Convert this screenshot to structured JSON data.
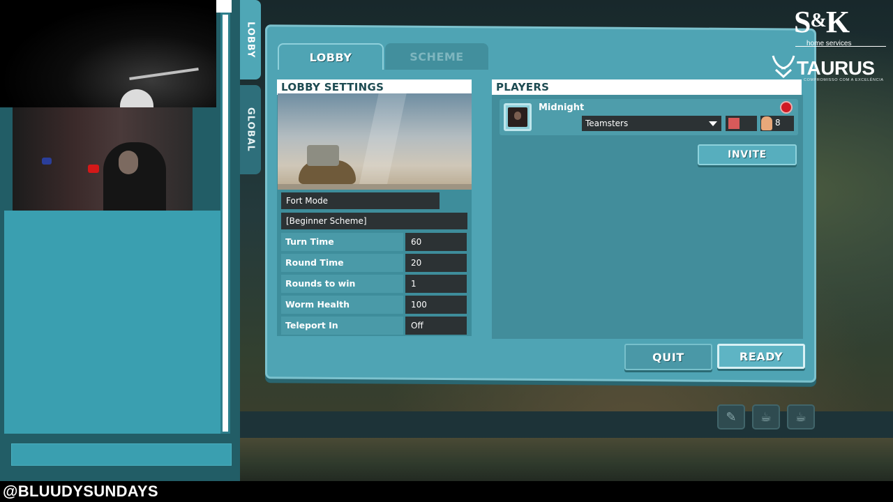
{
  "stream": {
    "handle": "@BLUUDYSUNDAYS"
  },
  "sponsors": {
    "sk": {
      "letters_left": "S",
      "amp": "&",
      "letters_right": "K",
      "tagline": "home services"
    },
    "taurus": {
      "name": "TAURUS",
      "tagline": "COMPROMISSO COM A EXCELÊNCIA"
    }
  },
  "side_tabs": {
    "lobby": "LOBBY",
    "global": "GLOBAL"
  },
  "tabs": [
    {
      "label": "LOBBY",
      "active": true
    },
    {
      "label": "SCHEME",
      "active": false
    }
  ],
  "lobby_settings": {
    "title": "LOBBY SETTINGS",
    "mode": "Fort Mode",
    "scheme": "[Beginner Scheme]",
    "rows": [
      {
        "label": "Turn Time",
        "value": "60"
      },
      {
        "label": "Round Time",
        "value": "20"
      },
      {
        "label": "Rounds to win",
        "value": "1"
      },
      {
        "label": "Worm Health",
        "value": "100"
      },
      {
        "label": "Teleport In",
        "value": "Off"
      }
    ]
  },
  "players": {
    "title": "PLAYERS",
    "list": [
      {
        "name": "Midnight",
        "team": "Teamsters",
        "team_color": "#d85a5a",
        "worm_count": "8",
        "ready_indicator": "red"
      }
    ],
    "invite_label": "INVITE"
  },
  "actions": {
    "quit_label": "QUIT",
    "ready_label": "READY"
  },
  "hud_icons": [
    "chat-icon",
    "coffee-cup-icon",
    "tea-cup-icon"
  ],
  "colors": {
    "panel": "#4fa4b4",
    "field": "#2c3234",
    "ready_dot": "#d01a24"
  }
}
